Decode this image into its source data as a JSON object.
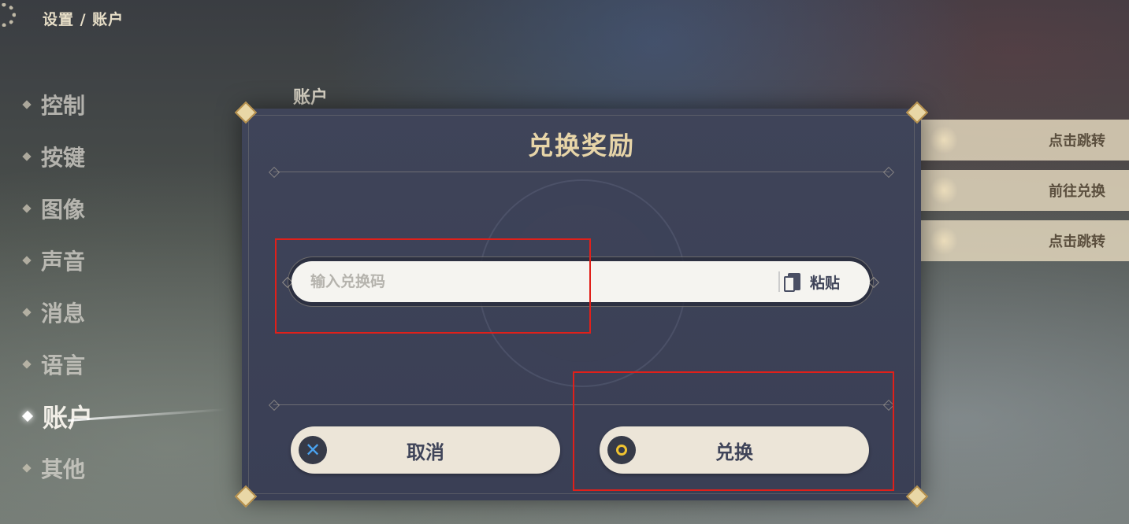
{
  "breadcrumb": "设置 / 账户",
  "menu": {
    "items": [
      {
        "label": "控制"
      },
      {
        "label": "按键"
      },
      {
        "label": "图像"
      },
      {
        "label": "声音"
      },
      {
        "label": "消息"
      },
      {
        "label": "语言"
      },
      {
        "label": "账户",
        "active": true
      },
      {
        "label": "其他"
      }
    ]
  },
  "section_title": "账户",
  "right_rows": [
    {
      "label": "点击跳转"
    },
    {
      "label": "前往兑换"
    },
    {
      "label": "点击跳转"
    }
  ],
  "dialog": {
    "title": "兑换奖励",
    "input": {
      "placeholder": "输入兑换码",
      "value": ""
    },
    "paste_label": "粘贴",
    "cancel_label": "取消",
    "confirm_label": "兑换",
    "cancel_icon": "✕"
  },
  "colors": {
    "accent_gold": "#e7d5a8",
    "dialog_bg": "#3f4459",
    "button_bg": "#ece5d8",
    "annotation_red": "#e0201a"
  }
}
